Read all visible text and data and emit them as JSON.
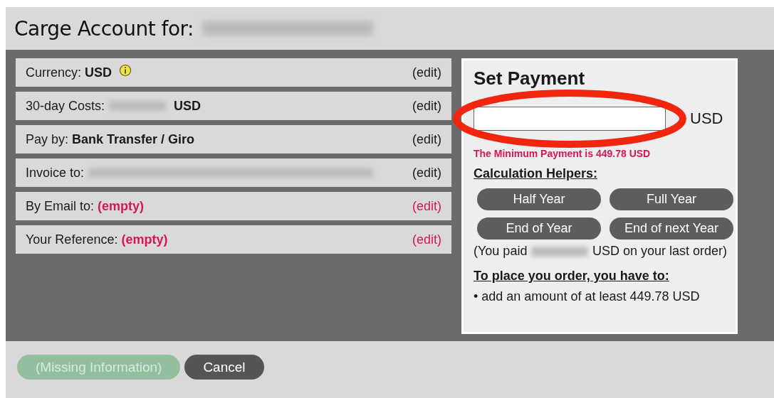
{
  "dialog": {
    "title": "Carge Account for:",
    "title_value_redacted": true
  },
  "fields": [
    {
      "label": "Currency:",
      "value": "USD",
      "value_redacted": false,
      "info": true,
      "edit": "(edit)",
      "missing": false
    },
    {
      "label": "30-day Costs:",
      "value": "USD",
      "value_redacted": true,
      "info": false,
      "edit": "(edit)",
      "missing": false
    },
    {
      "label": "Pay by:",
      "value": "Bank Transfer / Giro",
      "value_redacted": false,
      "info": false,
      "edit": "(edit)",
      "missing": false
    },
    {
      "label": "Invoice to:",
      "value_redacted": true,
      "info": false,
      "edit": "(edit)",
      "missing": false
    },
    {
      "label": "By Email to:",
      "value": "(empty)",
      "value_redacted": false,
      "info": false,
      "edit": "(edit)",
      "missing": true
    },
    {
      "label": "Your Reference:",
      "value": "(empty)",
      "value_redacted": false,
      "info": false,
      "edit": "(edit)",
      "missing": true
    }
  ],
  "payment": {
    "title": "Set Payment",
    "currency": "USD",
    "error": "The Minimum Payment is 449.78 USD",
    "helpers_title": "Calculation Helpers:",
    "helpers": [
      "Half Year",
      "Full Year",
      "End of Year",
      "End of next Year"
    ],
    "last_paid_before": "(You paid",
    "last_paid_redacted": true,
    "last_paid_after": "USD on your last order)",
    "todo_title": "To place you order, you have to:",
    "todo": [
      "• add an amount of at least 449.78 USD"
    ],
    "input_circled": true
  },
  "buttons": [
    {
      "label": "(Missing Information)",
      "disabled": true,
      "kind": "primary"
    },
    {
      "label": "Cancel",
      "disabled": false,
      "kind": "secondary"
    }
  ]
}
